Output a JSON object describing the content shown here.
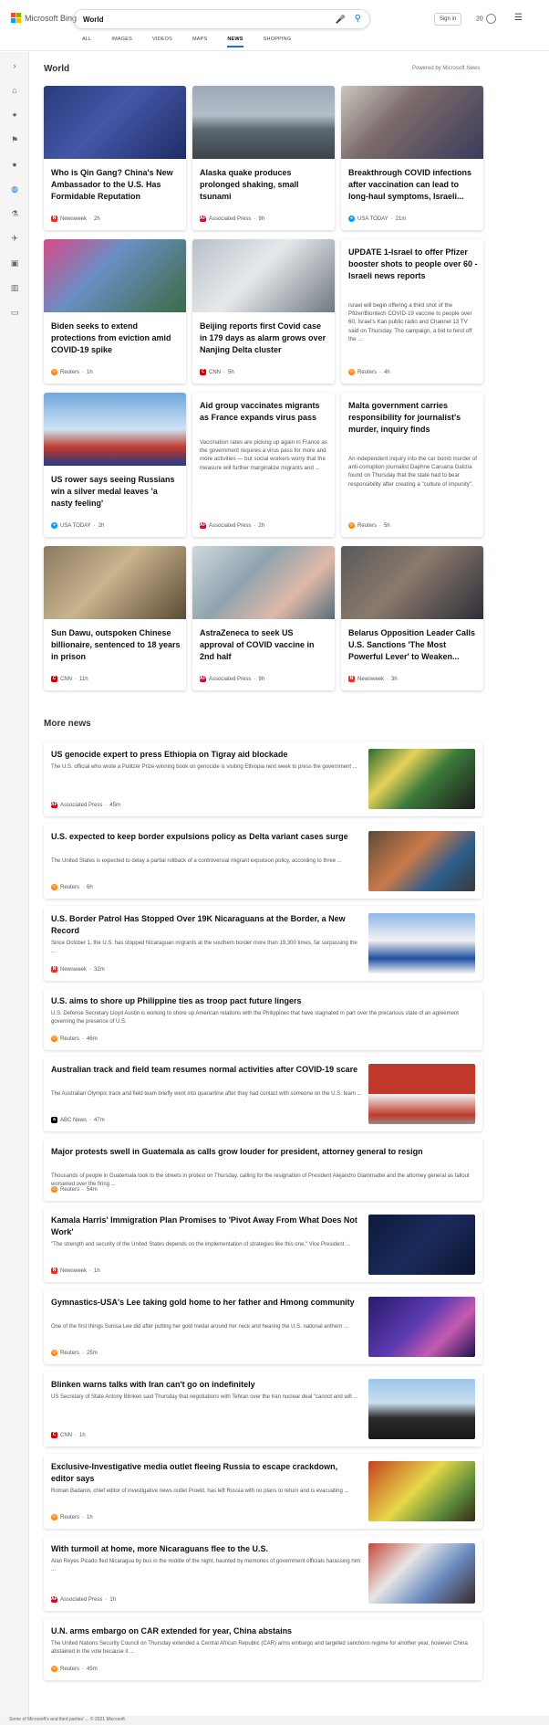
{
  "brand": "Microsoft Bing",
  "search": {
    "value": "World"
  },
  "header": {
    "signin": "Sign in",
    "rewards": "20"
  },
  "tabs": [
    {
      "label": "ALL"
    },
    {
      "label": "IMAGES"
    },
    {
      "label": "VIDEOS"
    },
    {
      "label": "MAPS"
    },
    {
      "label": "NEWS",
      "active": true
    },
    {
      "label": "SHOPPING"
    }
  ],
  "sidebar_icons": [
    "expand-icon",
    "home-icon",
    "sports-icon",
    "flag-icon",
    "location-icon",
    "globe-icon",
    "science-icon",
    "tech-icon",
    "entertainment-icon",
    "politics-icon",
    "money-icon"
  ],
  "section": {
    "world": "World",
    "powered": "Powered by Microsoft News",
    "more": "More news"
  },
  "colors": {
    "accent": "#1a73c8",
    "newsweek": "#e8302a",
    "ap": "#c8102e",
    "usatoday": "#009bff",
    "reuters": "#ff8000",
    "cnn": "#cc0000",
    "abc": "#000000"
  },
  "cards": [
    {
      "title": "Who is Qin Gang? China's New Ambassador to the U.S. Has Formidable Reputation",
      "snippet": "",
      "source": "Newsweek",
      "time": "2h",
      "pub": "newsweek",
      "img": "linear-gradient(135deg,#2a3b7a 0%,#4457a8 45%,#1f2d66 100%)"
    },
    {
      "title": "Alaska quake produces prolonged shaking, small tsunami",
      "snippet": "",
      "source": "Associated Press",
      "time": "9h",
      "pub": "ap",
      "img": "linear-gradient(180deg,#9aa8b8 0%,#b5bfc9 40%,#5d6770 60%,#3d4349 100%)"
    },
    {
      "title": "Breakthrough COVID infections after vaccination can lead to long-haul symptoms, Israeli...",
      "snippet": "",
      "source": "USA TODAY",
      "time": "21m",
      "pub": "usatoday",
      "img": "linear-gradient(135deg,#ccc7c0 0%,#7a6a6a 40%,#3b3b5c 100%)"
    },
    {
      "title": "Biden seeks to extend protections from eviction amid COVID-19 spike",
      "snippet": "",
      "source": "Reuters",
      "time": "1h",
      "pub": "reuters",
      "img": "linear-gradient(135deg,#d44b8a 0%,#6a8fc4 40%,#3c6a46 100%)"
    },
    {
      "title": "Beijing reports first Covid case in 179 days as alarm grows over Nanjing Delta cluster",
      "snippet": "",
      "source": "CNN",
      "time": "5h",
      "pub": "cnn",
      "img": "linear-gradient(135deg,#b8c0c8 0%,#e6e9ec 45%,#707880 100%)"
    },
    {
      "title": "UPDATE 1-Israel to offer Pfizer booster shots to people over 60 - Israeli news reports",
      "snippet": "Israel will begin offering a third shot of the Pfizer/Biontech COVID-19 vaccine to people over 60, Israel's Kan public radio and Channel 13 TV said on Thursday. The campaign, a bid to fend off the ...",
      "source": "Reuters",
      "time": "4h",
      "pub": "reuters",
      "img": ""
    },
    {
      "title": "US rower says seeing Russians win a silver medal leaves 'a nasty feeling'",
      "snippet": "",
      "source": "USA TODAY",
      "time": "2h",
      "pub": "usatoday",
      "img": "linear-gradient(180deg,#6fa8dc 0%,#cfe2f3 50%,#c0392b 75%,#1f3c8c 100%)"
    },
    {
      "title": "Aid group vaccinates migrants as France expands virus pass",
      "snippet": "Vaccination rates are picking up again in France as the government requires a virus pass for more and more activities — but social workers worry that the measure will further marginalize migrants and ...",
      "source": "Associated Press",
      "time": "2h",
      "pub": "ap",
      "img": ""
    },
    {
      "title": "Malta government carries responsibility for journalist's murder, inquiry finds",
      "snippet": "An independent inquiry into the car bomb murder of anti-corruption journalist Daphne Caruana Galizia found on Thursday that the state had to bear responsibility after creating a \"culture of impunity\".",
      "source": "Reuters",
      "time": "5h",
      "pub": "reuters",
      "img": ""
    },
    {
      "title": "Sun Dawu, outspoken Chinese billionaire, sentenced to 18 years in prison",
      "snippet": "",
      "source": "CNN",
      "time": "11h",
      "pub": "cnn",
      "img": "linear-gradient(135deg,#8c7a60 0%,#c9b48e 45%,#5b4a35 100%)"
    },
    {
      "title": "AstraZeneca to seek US approval of COVID vaccine in 2nd half",
      "snippet": "",
      "source": "Associated Press",
      "time": "9h",
      "pub": "ap",
      "img": "linear-gradient(135deg,#cfd8dc 0%,#90a4ae 40%,#e0b8a8 70%,#546e7a 100%)"
    },
    {
      "title": "Belarus Opposition Leader Calls U.S. Sanctions 'The Most Powerful Lever' to Weaken...",
      "snippet": "",
      "source": "Newsweek",
      "time": "3h",
      "pub": "newsweek",
      "img": "linear-gradient(135deg,#5a5a5a 0%,#8a7a6c 45%,#2e2e3a 100%)"
    }
  ],
  "more": [
    {
      "title": "US genocide expert to press Ethiopia on Tigray aid blockade",
      "snippet": "The U.S. official who wrote a Pulitzer Prize-winning book on genocide is visiting Ethiopia next week to press the government ...",
      "source": "Associated Press",
      "time": "45m",
      "pub": "ap",
      "thumb": "linear-gradient(135deg,#2f6b2f 0%,#e6d35a 30%,#3b7a3b 55%,#1d1d1d 100%)"
    },
    {
      "title": "U.S. expected to keep border expulsions policy as Delta variant cases surge",
      "snippet": "The United States is expected to delay a partial rollback of a controversial migrant expulsion policy, according to three ...",
      "source": "Reuters",
      "time": "6h",
      "pub": "reuters",
      "thumb": "linear-gradient(135deg,#5d4a3a 0%,#c97b4a 40%,#2b5d8a 70%,#3a3a3a 100%)"
    },
    {
      "title": "U.S. Border Patrol Has Stopped Over 19K Nicaraguans at the Border, a New Record",
      "snippet": "Since October 1, the U.S. has stopped Nicaraguan migrants at the southern border more than 19,300 times, far surpassing the ...",
      "source": "Newsweek",
      "time": "32m",
      "pub": "newsweek",
      "thumb": "linear-gradient(180deg,#8fb7e6 0%,#f2f2f2 45%,#1f4fa0 75%,#f2f2f2 100%)"
    },
    {
      "title": "U.S. aims to shore up Philippine ties as troop pact future lingers",
      "snippet": "U.S. Defense Secretary Lloyd Austin is working to shore up American relations with the Philippines that have stagnated in part over the precarious state of an agreement governing the presence of U.S.",
      "source": "Reuters",
      "time": "46m",
      "pub": "reuters",
      "thumb": ""
    },
    {
      "title": "Australian track and field team resumes normal activities after COVID-19 scare",
      "snippet": "The Australian Olympic track and field team briefly went into quarantine after they had contact with someone on the U.S. team ...",
      "source": "ABC News",
      "time": "47m",
      "pub": "abc",
      "thumb": "linear-gradient(180deg,#c0392b 0%,#c0392b 50%,#f2f2f2 50%,#c0392b 85%,#8e8e8e 100%)"
    },
    {
      "title": "Major protests swell in Guatemala as calls grow louder for president, attorney general to resign",
      "snippet": "Thousands of people in Guatemala took to the streets in protest on Thursday, calling for the resignation of President Alejandro Giammattei and the attorney general as fallout worsened over the firing ...",
      "source": "Reuters",
      "time": "54m",
      "pub": "reuters",
      "thumb": ""
    },
    {
      "title": "Kamala Harris' Immigration Plan Promises to 'Pivot Away From What Does Not Work'",
      "snippet": "\"The strength and security of the United States depends on the implementation of strategies like this one,\" Vice President ...",
      "source": "Newsweek",
      "time": "1h",
      "pub": "newsweek",
      "thumb": "linear-gradient(135deg,#0d1a3a 0%,#1b2a5c 50%,#0b1530 100%)"
    },
    {
      "title": "Gymnastics-USA's Lee taking gold home to her father and Hmong community",
      "snippet": "One of the first things Sunisa Lee did after putting her gold medal around her neck and hearing the U.S. national anthem ...",
      "source": "Reuters",
      "time": "25m",
      "pub": "reuters",
      "thumb": "linear-gradient(135deg,#2a1b6a 0%,#5b3ab0 45%,#c45ab0 70%,#1c1450 100%)"
    },
    {
      "title": "Blinken warns talks with Iran can't go on indefinitely",
      "snippet": "US Secretary of State Antony Blinken said Thursday that negotiations with Tehran over the Iran nuclear deal \"cannot and will ...",
      "source": "CNN",
      "time": "1h",
      "pub": "cnn",
      "thumb": "linear-gradient(180deg,#9ec5e8 0%,#c9dff0 40%,#2a2a2a 65%,#1a1a1a 100%)"
    },
    {
      "title": "Exclusive-Investigative media outlet fleeing Russia to escape crackdown, editor says",
      "snippet": "Roman Badanin, chief editor of investigative news outlet Proekt, has left Russia with no plans to return and is evacuating ...",
      "source": "Reuters",
      "time": "1h",
      "pub": "reuters",
      "thumb": "linear-gradient(135deg,#c4441f 0%,#e6d84a 45%,#5a8a3a 75%,#3a2a1a 100%)"
    },
    {
      "title": "With turmoil at home, more Nicaraguans flee to the U.S.",
      "snippet": "Alan Reyes Picado fled Nicaragua by bus in the middle of the night, haunted by memories of government officials harassing him ...",
      "source": "Associated Press",
      "time": "1h",
      "pub": "ap",
      "thumb": "linear-gradient(135deg,#c44a3a 0%,#e6e6e6 35%,#6a8ac0 65%,#3a2a2a 100%)"
    },
    {
      "title": "U.N. arms embargo on CAR extended for year, China abstains",
      "snippet": "The United Nations Security Council on Thursday extended a Central African Republic (CAR) arms embargo and targeted sanctions regime for another year, however China abstained in the vote because it ...",
      "source": "Reuters",
      "time": "45m",
      "pub": "reuters",
      "thumb": ""
    }
  ],
  "footer": "Some of Microsoft's and third parties' ...  © 2021 Microsoft"
}
